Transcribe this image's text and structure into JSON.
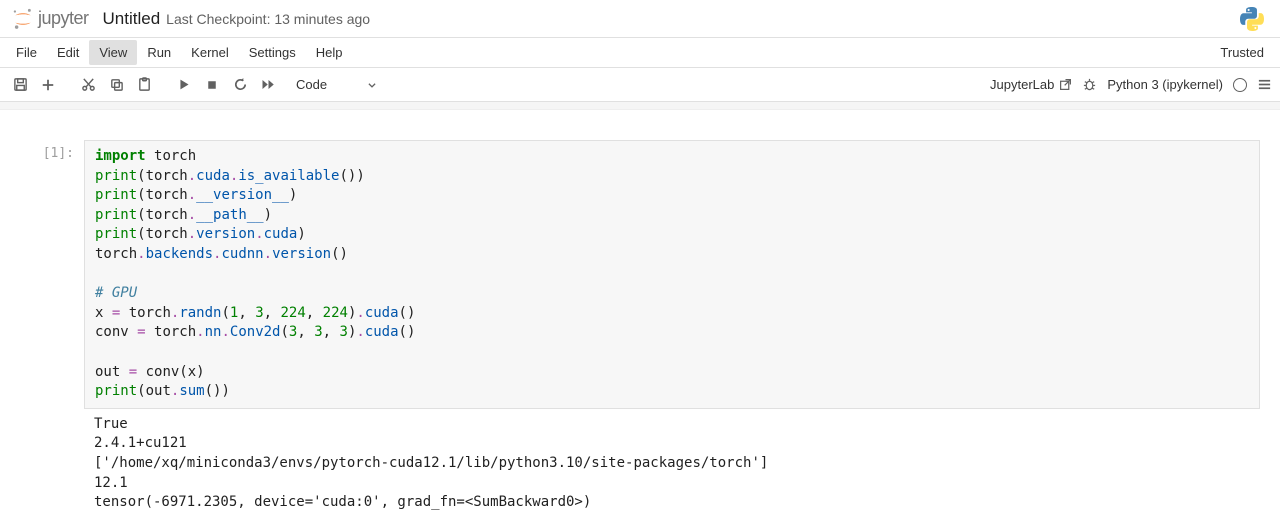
{
  "header": {
    "logo_text": "jupyter",
    "title": "Untitled",
    "checkpoint": "Last Checkpoint: 13 minutes ago"
  },
  "menubar": {
    "items": [
      "File",
      "Edit",
      "View",
      "Run",
      "Kernel",
      "Settings",
      "Help"
    ],
    "active_index": 2,
    "trusted": "Trusted"
  },
  "toolbar": {
    "cell_type": "Code",
    "jupyterlab": "JupyterLab",
    "kernel": "Python 3 (ipykernel)"
  },
  "cell": {
    "prompt": "[1]:",
    "code_tokens": [
      [
        [
          "kw",
          "import"
        ],
        [
          "sp",
          " "
        ],
        [
          "name",
          "torch"
        ]
      ],
      [
        [
          "bi",
          "print"
        ],
        [
          "name",
          "(torch"
        ],
        [
          "op",
          "."
        ],
        [
          "attr",
          "cuda"
        ],
        [
          "op",
          "."
        ],
        [
          "attr",
          "is_available"
        ],
        [
          "name",
          "())"
        ]
      ],
      [
        [
          "bi",
          "print"
        ],
        [
          "name",
          "(torch"
        ],
        [
          "op",
          "."
        ],
        [
          "attr",
          "__version__"
        ],
        [
          "name",
          ")"
        ]
      ],
      [
        [
          "bi",
          "print"
        ],
        [
          "name",
          "(torch"
        ],
        [
          "op",
          "."
        ],
        [
          "attr",
          "__path__"
        ],
        [
          "name",
          ")"
        ]
      ],
      [
        [
          "bi",
          "print"
        ],
        [
          "name",
          "(torch"
        ],
        [
          "op",
          "."
        ],
        [
          "attr",
          "version"
        ],
        [
          "op",
          "."
        ],
        [
          "attr",
          "cuda"
        ],
        [
          "name",
          ")"
        ]
      ],
      [
        [
          "name",
          "torch"
        ],
        [
          "op",
          "."
        ],
        [
          "attr",
          "backends"
        ],
        [
          "op",
          "."
        ],
        [
          "attr",
          "cudnn"
        ],
        [
          "op",
          "."
        ],
        [
          "attr",
          "version"
        ],
        [
          "name",
          "()"
        ]
      ],
      [],
      [
        [
          "cmt",
          "# GPU"
        ]
      ],
      [
        [
          "name",
          "x "
        ],
        [
          "op",
          "="
        ],
        [
          "name",
          " torch"
        ],
        [
          "op",
          "."
        ],
        [
          "attr",
          "randn"
        ],
        [
          "name",
          "("
        ],
        [
          "num",
          "1"
        ],
        [
          "name",
          ", "
        ],
        [
          "num",
          "3"
        ],
        [
          "name",
          ", "
        ],
        [
          "num",
          "224"
        ],
        [
          "name",
          ", "
        ],
        [
          "num",
          "224"
        ],
        [
          "name",
          ")"
        ],
        [
          "op",
          "."
        ],
        [
          "attr",
          "cuda"
        ],
        [
          "name",
          "()"
        ]
      ],
      [
        [
          "name",
          "conv "
        ],
        [
          "op",
          "="
        ],
        [
          "name",
          " torch"
        ],
        [
          "op",
          "."
        ],
        [
          "attr",
          "nn"
        ],
        [
          "op",
          "."
        ],
        [
          "attr",
          "Conv2d"
        ],
        [
          "name",
          "("
        ],
        [
          "num",
          "3"
        ],
        [
          "name",
          ", "
        ],
        [
          "num",
          "3"
        ],
        [
          "name",
          ", "
        ],
        [
          "num",
          "3"
        ],
        [
          "name",
          ")"
        ],
        [
          "op",
          "."
        ],
        [
          "attr",
          "cuda"
        ],
        [
          "name",
          "()"
        ]
      ],
      [],
      [
        [
          "name",
          "out "
        ],
        [
          "op",
          "="
        ],
        [
          "name",
          " conv(x)"
        ]
      ],
      [
        [
          "bi",
          "print"
        ],
        [
          "name",
          "(out"
        ],
        [
          "op",
          "."
        ],
        [
          "attr",
          "sum"
        ],
        [
          "name",
          "())"
        ]
      ]
    ],
    "output": [
      "True",
      "2.4.1+cu121",
      "['/home/xq/miniconda3/envs/pytorch-cuda12.1/lib/python3.10/site-packages/torch']",
      "12.1",
      "tensor(-6971.2305, device='cuda:0', grad_fn=<SumBackward0>)"
    ]
  }
}
